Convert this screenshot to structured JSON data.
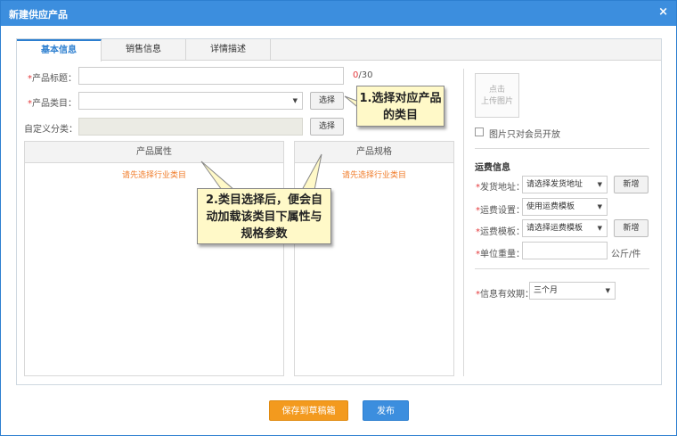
{
  "dialog": {
    "title": "新建供应产品",
    "close_glyph": "×"
  },
  "tabs": [
    {
      "label": "基本信息",
      "active": true
    },
    {
      "label": "销售信息",
      "active": false
    },
    {
      "label": "详情描述",
      "active": false
    }
  ],
  "form": {
    "product_title": {
      "label": "产品标题：",
      "value": "",
      "counter_current": "0",
      "counter_max": "/30"
    },
    "product_category": {
      "label": "产品类目：",
      "value": "",
      "button": "选择"
    },
    "custom_category": {
      "label": "自定义分类：",
      "value": "",
      "button": "选择"
    },
    "required_mark": "*"
  },
  "attributes_box": {
    "header": "产品属性",
    "hint": "请先选择行业类目"
  },
  "specs_box": {
    "header": "产品规格",
    "hint": "请先选择行业类目"
  },
  "callouts": {
    "first": "1.选择对应产品的类目",
    "second": "2.类目选择后，便会自动加载该类目下属性与规格参数"
  },
  "right_panel": {
    "upload": {
      "line1": "点击",
      "line2": "上传图片"
    },
    "members_only": {
      "label": "图片只对会员开放",
      "checked": false
    },
    "shipping_title": "运费信息",
    "ship_from": {
      "label": "发货地址：",
      "value": "请选择发货地址",
      "button": "新增"
    },
    "freight_setting": {
      "label": "运费设置：",
      "value": "使用运费模板"
    },
    "freight_template": {
      "label": "运费模板：",
      "value": "请选择运费模板",
      "button": "新增"
    },
    "unit_weight": {
      "label": "单位重量：",
      "value": "",
      "unit": "公斤/件"
    },
    "validity": {
      "label": "信息有效期：",
      "value": "三个月"
    }
  },
  "footer": {
    "save_draft": "保存到草稿箱",
    "publish": "发布"
  },
  "colors": {
    "accent": "#3c8ede",
    "orange": "#f39a1e",
    "hint": "#f07c2a",
    "required": "#e4393c",
    "callout_bg": "#fff9c8"
  }
}
